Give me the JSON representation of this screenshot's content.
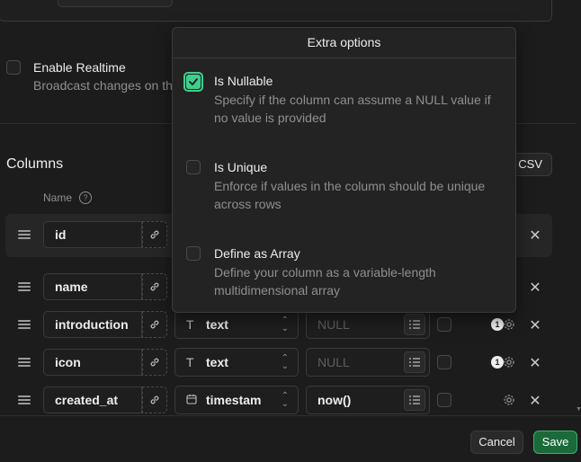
{
  "realtime": {
    "title": "Enable Realtime",
    "description": "Broadcast changes on th"
  },
  "columns": {
    "title": "Columns",
    "name_header": "Name",
    "help_glyph": "?",
    "import_csv_label": "n CSV",
    "rows": [
      {
        "name": "id"
      },
      {
        "name": "name"
      },
      {
        "name": "introduction",
        "type": "text",
        "type_icon": "T",
        "default": "NULL",
        "default_is_placeholder": true,
        "badge": "1"
      },
      {
        "name": "icon",
        "type": "text",
        "type_icon": "T",
        "default": "NULL",
        "default_is_placeholder": true,
        "badge": "1"
      },
      {
        "name": "created_at",
        "type": "timestam",
        "type_icon": "calendar-icon",
        "default": "now()",
        "default_is_placeholder": false
      }
    ]
  },
  "popover": {
    "title": "Extra options",
    "options": [
      {
        "title": "Is Nullable",
        "description": "Specify if the column can assume a NULL value if no value is provided",
        "checked": true
      },
      {
        "title": "Is Unique",
        "description": "Enforce if values in the column should be unique across rows",
        "checked": false
      },
      {
        "title": "Define as Array",
        "description": "Define your column as a variable-length multidimensional array",
        "checked": false
      }
    ]
  },
  "footer": {
    "cancel_label": "Cancel",
    "save_label": "Save"
  },
  "colors": {
    "background": "#1c1c1c",
    "accent_green": "#3ecf8e",
    "save_button": "#1a6a3a"
  },
  "glyphs": {
    "close": "✕",
    "chevrons": "⌃⌄"
  }
}
